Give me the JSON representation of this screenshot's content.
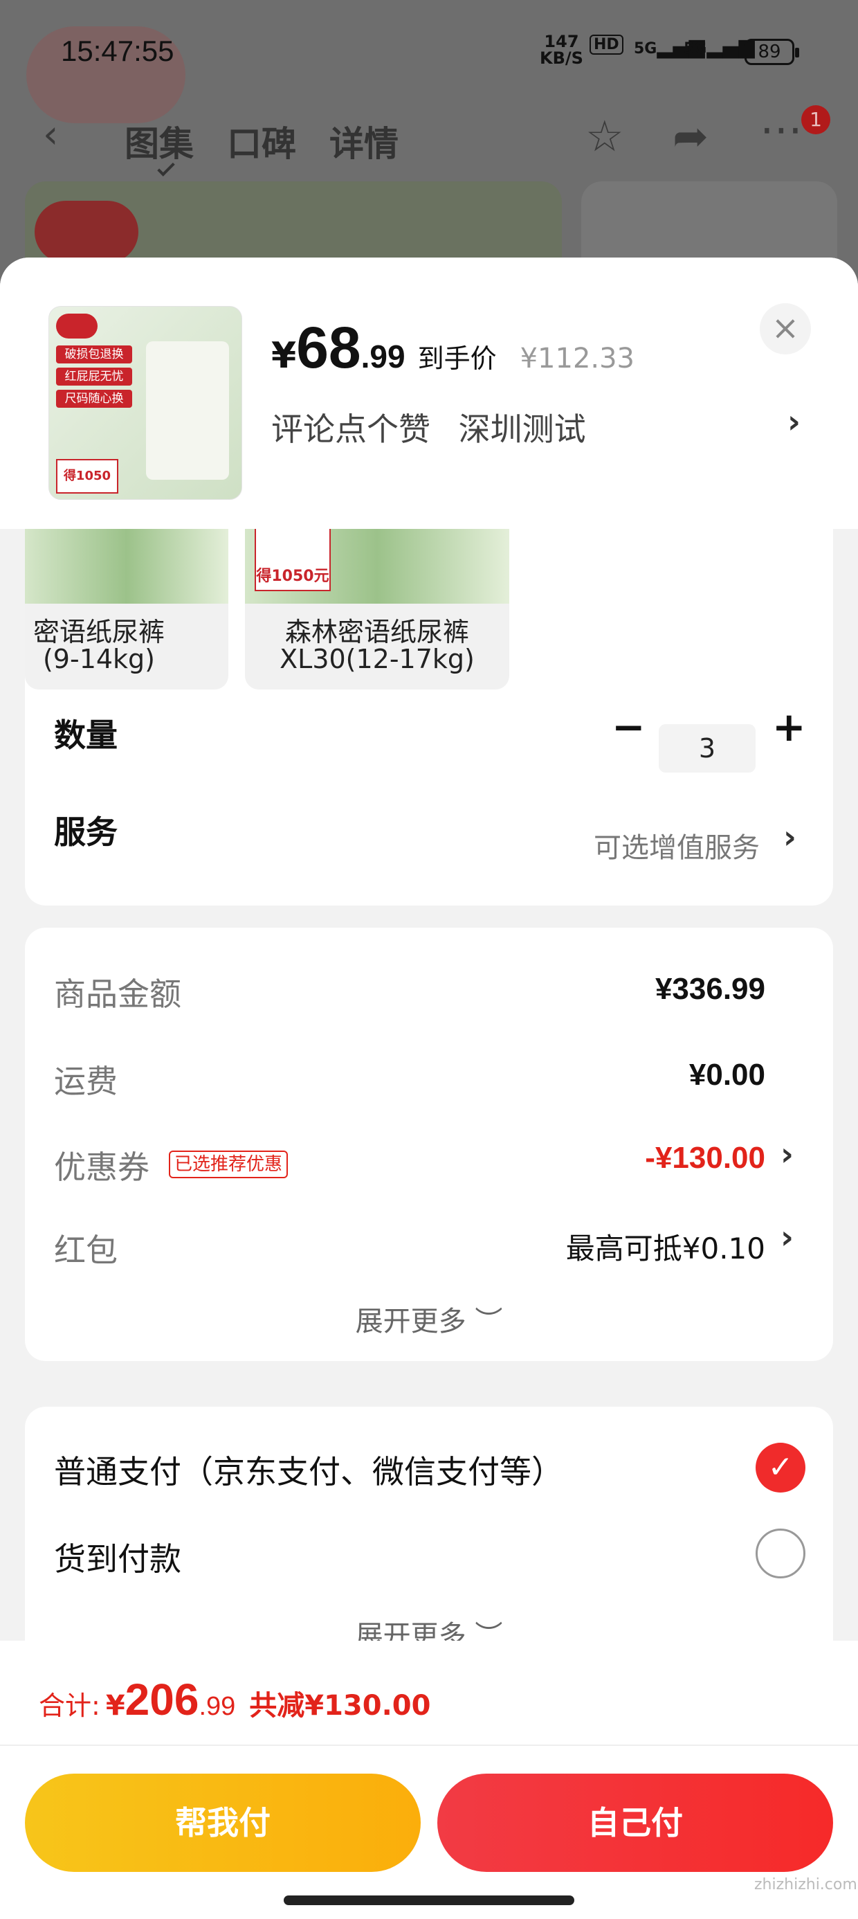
{
  "status_bar": {
    "time": "15:47:55",
    "net_speed": "147",
    "net_unit": "KB/S",
    "hd": "HD",
    "signal1": "5G",
    "signal2": "5G",
    "battery": "89"
  },
  "background": {
    "tabs": [
      "图集",
      "口碑",
      "详情"
    ],
    "cart_badge": "1",
    "icons": [
      "back-icon",
      "star-icon",
      "share-icon",
      "more-icon"
    ]
  },
  "product": {
    "currency": "¥",
    "price_int": "68",
    "price_dec": ".99",
    "price_label": "到手价",
    "original_price": "¥112.33",
    "sub_items": [
      "评论点个赞",
      "深圳测试"
    ],
    "close": "×",
    "chevron": "›",
    "thumb": {
      "labels": [
        "破损包退换",
        "红屁屁无忧",
        "尺码随心换"
      ],
      "price_text": "得1050元"
    }
  },
  "variants": [
    {
      "line1": "密语纸尿裤",
      "line2": "(9-14kg)",
      "tag": ""
    },
    {
      "line1": "森林密语纸尿裤",
      "line2": "XL30(12-17kg)",
      "tag": "得1050元"
    }
  ],
  "quantity": {
    "label": "数量",
    "minus": "−",
    "value": "3",
    "plus": "+"
  },
  "service": {
    "label": "服务",
    "value": "可选增值服务",
    "chevron": "›"
  },
  "fees": {
    "goods_label": "商品金额",
    "goods_value": "¥336.99",
    "shipping_label": "运费",
    "shipping_value": "¥0.00",
    "coupon_label": "优惠券",
    "coupon_tag": "已选推荐优惠",
    "coupon_value": "-¥130.00",
    "redpacket_label": "红包",
    "redpacket_value": "最高可抵¥0.10",
    "expand": "展开更多 ︶",
    "accent_color": "#e2231a"
  },
  "payment": {
    "option1": "普通支付（京东支付、微信支付等）",
    "option2": "货到付款",
    "check_icon": "✓",
    "expand": "展开更多 ︶"
  },
  "footer": {
    "total_label": "合计:",
    "currency": "¥",
    "total_int": "206",
    "total_dec": ".99",
    "saved": "共减¥130.00",
    "help_pay": "帮我付",
    "self_pay": "自己付",
    "watermark": "zhizhizhi.com"
  }
}
